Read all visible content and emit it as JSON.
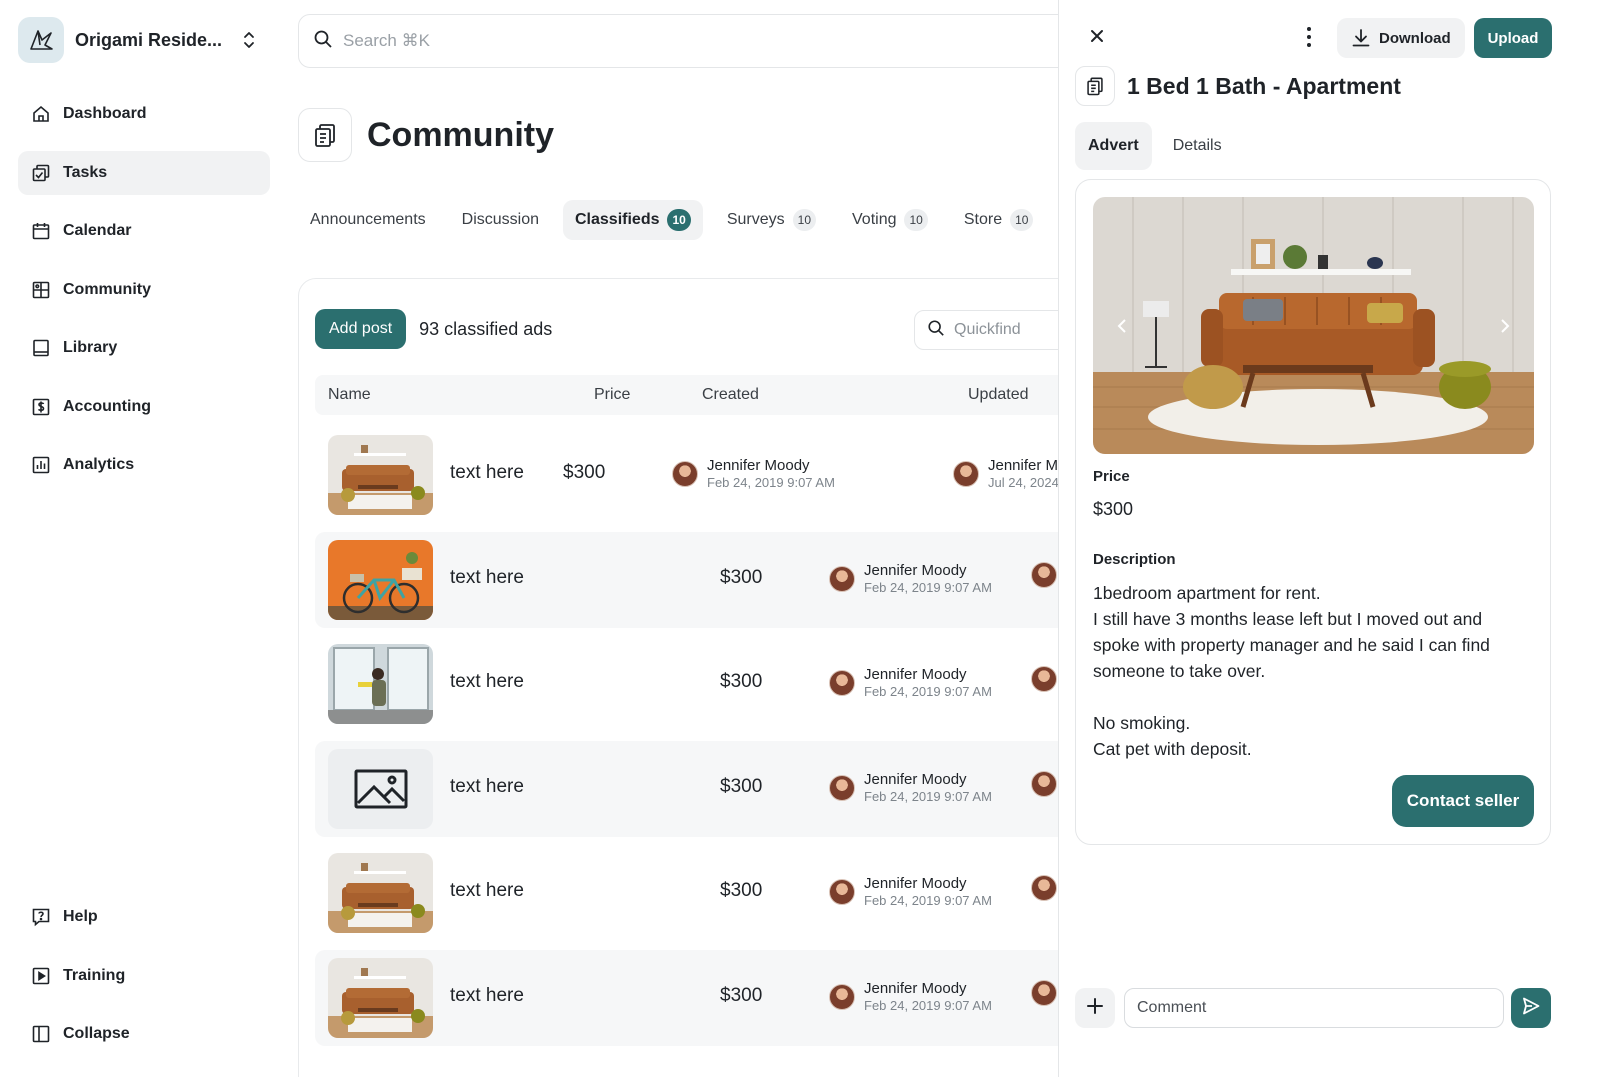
{
  "org": {
    "name": "Origami Reside..."
  },
  "nav": {
    "items": [
      {
        "label": "Dashboard",
        "icon": "home-icon"
      },
      {
        "label": "Tasks",
        "icon": "tasks-icon",
        "active": true
      },
      {
        "label": "Calendar",
        "icon": "calendar-icon"
      },
      {
        "label": "Community",
        "icon": "community-icon"
      },
      {
        "label": "Library",
        "icon": "library-icon"
      },
      {
        "label": "Accounting",
        "icon": "accounting-icon"
      },
      {
        "label": "Analytics",
        "icon": "analytics-icon"
      }
    ],
    "bottom": [
      {
        "label": "Help",
        "icon": "help-icon"
      },
      {
        "label": "Training",
        "icon": "training-icon"
      },
      {
        "label": "Collapse",
        "icon": "collapse-icon"
      }
    ]
  },
  "search": {
    "placeholder": "Search ⌘K"
  },
  "page": {
    "title": "Community"
  },
  "tabs": [
    {
      "label": "Announcements"
    },
    {
      "label": "Discussion"
    },
    {
      "label": "Classifieds",
      "badge": "10",
      "active": true
    },
    {
      "label": "Surveys",
      "badge": "10"
    },
    {
      "label": "Voting",
      "badge": "10"
    },
    {
      "label": "Store",
      "badge": "10"
    }
  ],
  "list": {
    "add_button": "Add post",
    "count_label": "93 classified ads",
    "quickfind_placeholder": "Quickfind",
    "columns": {
      "name": "Name",
      "price": "Price",
      "created": "Created",
      "updated": "Updated"
    },
    "rows": [
      {
        "image": "living-room",
        "name": "text here",
        "price": "$300",
        "created_by": "Jennifer Moody",
        "created_at": "Feb 24, 2019 9:07 AM",
        "updated_by": "Jennifer M",
        "updated_at": "Jul 24, 2024"
      },
      {
        "image": "bicycle",
        "name": "text here",
        "price": "$300",
        "created_by": "Jennifer Moody",
        "created_at": "Feb 24, 2019 9:07 AM"
      },
      {
        "image": "window-cleaning",
        "name": "text here",
        "price": "$300",
        "created_by": "Jennifer Moody",
        "created_at": "Feb 24, 2019 9:07 AM"
      },
      {
        "image": "placeholder",
        "name": "text here",
        "price": "$300",
        "created_by": "Jennifer Moody",
        "created_at": "Feb 24, 2019 9:07 AM"
      },
      {
        "image": "living-room",
        "name": "text here",
        "price": "$300",
        "created_by": "Jennifer Moody",
        "created_at": "Feb 24, 2019 9:07 AM"
      },
      {
        "image": "living-room",
        "name": "text here",
        "price": "$300",
        "created_by": "Jennifer Moody",
        "created_at": "Feb 24, 2019 9:07 AM"
      }
    ]
  },
  "panel": {
    "download_label": "Download",
    "upload_label": "Upload",
    "title": "1 Bed 1 Bath - Apartment",
    "tabs": [
      {
        "label": "Advert",
        "active": true
      },
      {
        "label": "Details"
      }
    ],
    "price_label": "Price",
    "price_value": "$300",
    "description_label": "Description",
    "description_lines": [
      "1bedroom apartment for rent.",
      "I still have 3 months lease left but I moved out and spoke with property manager and he said I can find someone to take over.",
      "",
      "No smoking.",
      "Cat pet with deposit."
    ],
    "contact_label": "Contact seller",
    "comment_placeholder": "Comment"
  },
  "colors": {
    "accent": "#2b6f6f",
    "muted_bg": "#f1f2f3",
    "border": "#e4e6e8"
  }
}
